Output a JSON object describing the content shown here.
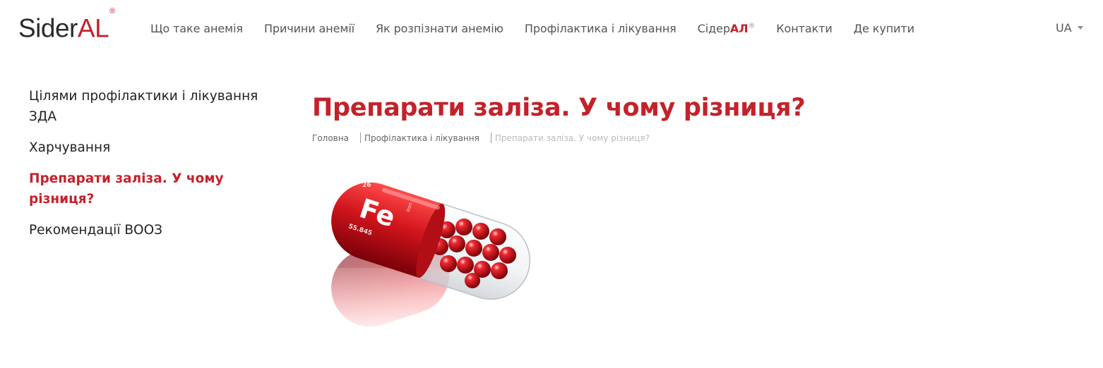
{
  "header": {
    "logo": {
      "part1": "Sider",
      "part2": "AL",
      "mark": "®"
    },
    "nav": [
      {
        "label": "Що таке анемія"
      },
      {
        "label": "Причини анемії"
      },
      {
        "label": "Як розпізнати анемію"
      },
      {
        "label": "Профілактика і лікування"
      },
      {
        "label_prefix": "Сідер",
        "label_accent": "АЛ",
        "mark": "®"
      },
      {
        "label": "Контакти"
      },
      {
        "label": "Де купити"
      }
    ],
    "language": "UA"
  },
  "sidebar": {
    "items": [
      {
        "label": "Цілями профілактики і лікування ЗДА",
        "active": false
      },
      {
        "label": "Харчування",
        "active": false
      },
      {
        "label": "Препарати заліза. У чому різниця?",
        "active": true
      },
      {
        "label": "Рекомендації ВООЗ",
        "active": false
      }
    ]
  },
  "main": {
    "title": "Препарати заліза. У чому різниця?",
    "breadcrumb": {
      "home": "Головна",
      "section": "Профілактика і лікування",
      "current": "Препарати заліза. У чому різниця?"
    },
    "image": {
      "capsule_label": "Fe",
      "atomic_number": "26",
      "atomic_mass": "55.845",
      "side_text": "Iron"
    }
  },
  "colors": {
    "accent": "#c4222a",
    "text": "#333333",
    "muted": "#bbbbbb"
  }
}
